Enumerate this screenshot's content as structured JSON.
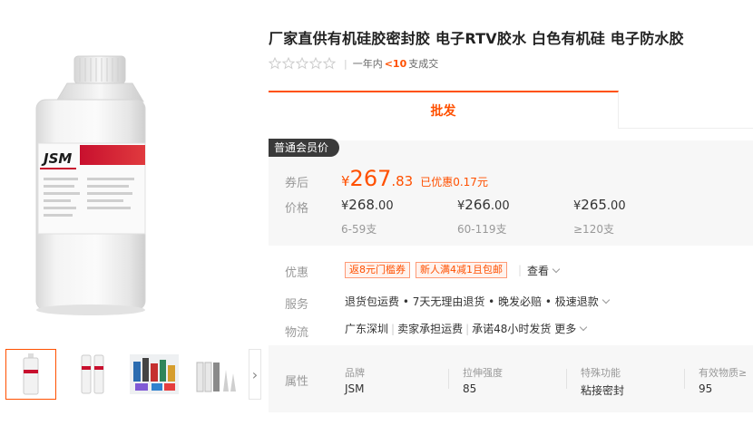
{
  "product": {
    "title": "厂家直供有机硅胶密封胶 电子RTV胶水 白色有机硅 电子防水胶",
    "rating_period": "一年内",
    "deals_count": "<10",
    "deals_unit": "支成交"
  },
  "tabs": [
    {
      "label": "批发"
    }
  ],
  "pricing": {
    "member_tag": "普通会员价",
    "coupon_label": "券后",
    "price_label": "价格",
    "coupon_price_currency": "¥",
    "coupon_price_int": "267",
    "coupon_price_dec": ".83",
    "coupon_saving": "已优惠0.17元",
    "tiers": [
      {
        "currency": "¥",
        "int": "268",
        "dec": ".00",
        "qty": "6-59支"
      },
      {
        "currency": "¥",
        "int": "266",
        "dec": ".00",
        "qty": "60-119支"
      },
      {
        "currency": "¥",
        "int": "265",
        "dec": ".00",
        "qty": "≥120支"
      }
    ]
  },
  "promotions": {
    "label": "优惠",
    "tags": [
      "返8元门槛券",
      "新人满4减1且包邮"
    ],
    "see_label": "查看"
  },
  "service": {
    "label": "服务",
    "text": "退货包运费 • 7天无理由退货 • 晚发必赔 • 极速退款"
  },
  "logistics": {
    "label": "物流",
    "origin": "广东深圳",
    "shipping": "卖家承担运费",
    "promise": "承诺48小时发货",
    "more_label": "更多"
  },
  "attributes": {
    "label": "属性",
    "items": [
      {
        "key": "品牌",
        "value": "JSM"
      },
      {
        "key": "拉伸强度",
        "value": "85"
      },
      {
        "key": "特殊功能",
        "value": "粘接密封"
      },
      {
        "key": "有效物质≥",
        "value": "95"
      }
    ]
  },
  "gallery": {
    "brand_mark": "JSM",
    "thumbnails": [
      "single-cartridge",
      "two-cartridges",
      "product-assortment",
      "cartridges-and-nozzles"
    ]
  },
  "colors": {
    "accent": "#ff5000",
    "panel_bg": "#f7f7f7",
    "member_tag_bg": "#3a3a3a"
  }
}
